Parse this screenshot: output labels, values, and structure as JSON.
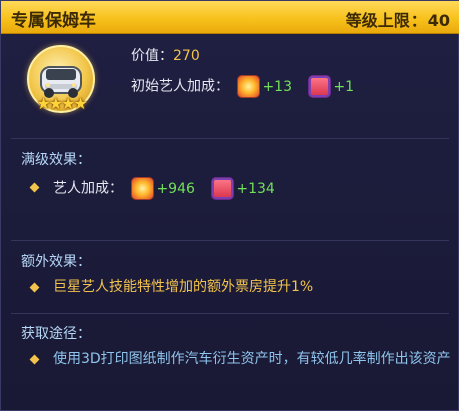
{
  "header": {
    "title": "专属保姆车",
    "level_label": "等级上限",
    "level_sep": "：",
    "level_value": "40"
  },
  "item": {
    "icon": "car-icon",
    "stars": "★★★★",
    "value_label": "价值：",
    "value": "270",
    "base_bonus_label": "初始艺人加成：",
    "base_bonus": [
      {
        "icon": "sun-burst-icon",
        "value": "+13"
      },
      {
        "icon": "cup-icon",
        "value": "+1"
      }
    ]
  },
  "max_level": {
    "title": "满级效果：",
    "label": "艺人加成：",
    "bonus": [
      {
        "icon": "sun-burst-icon",
        "value": "+946"
      },
      {
        "icon": "cup-icon",
        "value": "+134"
      }
    ]
  },
  "extra": {
    "title": "额外效果：",
    "text": "巨星艺人技能特性增加的额外票房提升1%"
  },
  "source": {
    "title": "获取途径：",
    "text": "使用3D打印图纸制作汽车衍生资产时，有较低几率制作出该资产"
  },
  "colors": {
    "title_bar": "#f8c21c",
    "gold_text": "#f3c34c",
    "green_text": "#72e05a",
    "blue_text": "#8fc4ec",
    "panel_bg": "#1c1c3c"
  }
}
